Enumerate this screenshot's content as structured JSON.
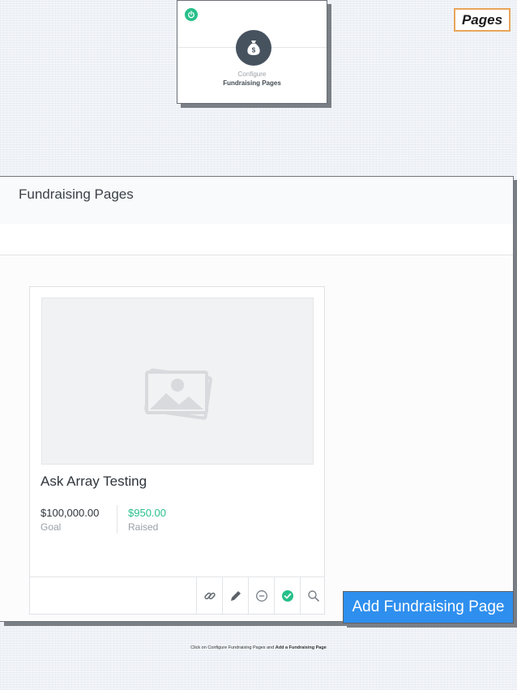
{
  "top_label": "Pages",
  "tile": {
    "line1": "Configure",
    "line2": "Fundraising Pages",
    "icons": [
      "power-icon",
      "money-bag-icon"
    ]
  },
  "panel": {
    "title": "Fundraising Pages",
    "card": {
      "name": "Ask Array Testing",
      "goal_value": "$100,000.00",
      "goal_label": "Goal",
      "raised_value": "$950.00",
      "raised_label": "Raised",
      "actions": [
        "link-icon",
        "pencil-icon",
        "minus-circle-icon",
        "check-circle-icon",
        "search-icon"
      ]
    }
  },
  "add_button": "Add Fundraising Page",
  "caption": {
    "prefix": "Click on Configure Fundraising Pages and",
    "bold": "Add a Fundraising Page"
  },
  "colors": {
    "accent_green": "#27c08a",
    "button_blue": "#2f8fee",
    "icon_dark": "#47525f",
    "highlight_border": "#e8a55a"
  }
}
